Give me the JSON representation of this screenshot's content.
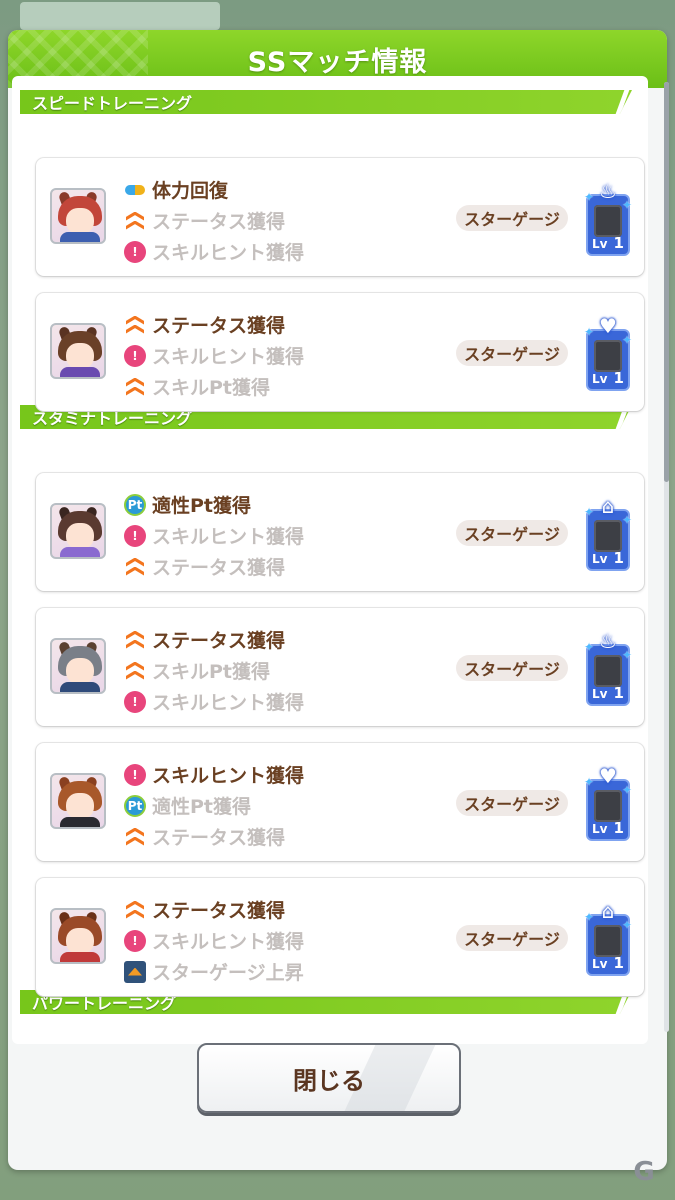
{
  "dialog": {
    "title": "SSマッチ情報",
    "close_label": "閉じる"
  },
  "sections": [
    {
      "label": "スピードトレーニング"
    },
    {
      "label": "スタミナトレーニング"
    },
    {
      "label": "パワートレーニング"
    }
  ],
  "gauge_label": "スターゲージ",
  "cards": [
    {
      "effects": [
        {
          "icon": "hp-recovery-icon",
          "text": "体力回復",
          "active": true
        },
        {
          "icon": "status-up-icon",
          "text": "ステータス獲得",
          "active": false
        },
        {
          "icon": "skill-hint-icon",
          "text": "スキルヒント獲得",
          "active": false
        }
      ],
      "badge": {
        "emblem": "flame-icon",
        "level_prefix": "Lv",
        "level": "1"
      },
      "avatar_colors": {
        "hair": "#c2463a",
        "ear": "#8a3a2a",
        "body": "#3d5fb0"
      }
    },
    {
      "effects": [
        {
          "icon": "status-up-icon",
          "text": "ステータス獲得",
          "active": true
        },
        {
          "icon": "skill-hint-icon",
          "text": "スキルヒント獲得",
          "active": false
        },
        {
          "icon": "status-up-icon",
          "text": "スキルPt獲得",
          "active": false
        }
      ],
      "badge": {
        "emblem": "heart-icon",
        "level_prefix": "Lv",
        "level": "1"
      },
      "avatar_colors": {
        "hair": "#6a4028",
        "ear": "#5a3322",
        "body": "#6a4bb0"
      }
    },
    {
      "effects": [
        {
          "icon": "aptitude-pt-icon",
          "text": "適性Pt獲得",
          "active": true
        },
        {
          "icon": "skill-hint-icon",
          "text": "スキルヒント獲得",
          "active": false
        },
        {
          "icon": "status-up-icon",
          "text": "ステータス獲得",
          "active": false
        }
      ],
      "badge": {
        "emblem": "graduation-cap-icon",
        "level_prefix": "Lv",
        "level": "1"
      },
      "avatar_colors": {
        "hair": "#5a3a30",
        "ear": "#3a2620",
        "body": "#8a6ad0"
      }
    },
    {
      "effects": [
        {
          "icon": "status-up-icon",
          "text": "ステータス獲得",
          "active": true
        },
        {
          "icon": "status-up-icon",
          "text": "スキルPt獲得",
          "active": false
        },
        {
          "icon": "skill-hint-icon",
          "text": "スキルヒント獲得",
          "active": false
        }
      ],
      "badge": {
        "emblem": "flame-icon",
        "level_prefix": "Lv",
        "level": "1"
      },
      "avatar_colors": {
        "hair": "#7a7f88",
        "ear": "#5a4030",
        "body": "#2f4a7a"
      }
    },
    {
      "effects": [
        {
          "icon": "skill-hint-icon",
          "text": "スキルヒント獲得",
          "active": true
        },
        {
          "icon": "aptitude-pt-icon",
          "text": "適性Pt獲得",
          "active": false
        },
        {
          "icon": "status-up-icon",
          "text": "ステータス獲得",
          "active": false
        }
      ],
      "badge": {
        "emblem": "heart-icon",
        "level_prefix": "Lv",
        "level": "1"
      },
      "avatar_colors": {
        "hair": "#a8582a",
        "ear": "#8a4020",
        "body": "#2a2a30"
      }
    },
    {
      "effects": [
        {
          "icon": "status-up-icon",
          "text": "ステータス獲得",
          "active": true
        },
        {
          "icon": "skill-hint-icon",
          "text": "スキルヒント獲得",
          "active": false
        },
        {
          "icon": "star-gauge-up-icon",
          "text": "スターゲージ上昇",
          "active": false
        }
      ],
      "badge": {
        "emblem": "graduation-cap-icon",
        "level_prefix": "Lv",
        "level": "1"
      },
      "avatar_colors": {
        "hair": "#9a4a28",
        "ear": "#6a3018",
        "body": "#c03a3a"
      }
    }
  ],
  "colors": {
    "accent_green": "#7cc81f",
    "active_text": "#6a4022",
    "inactive_text": "#c4bfbd",
    "badge_blue": "#3a67d8"
  },
  "watermark": "G"
}
